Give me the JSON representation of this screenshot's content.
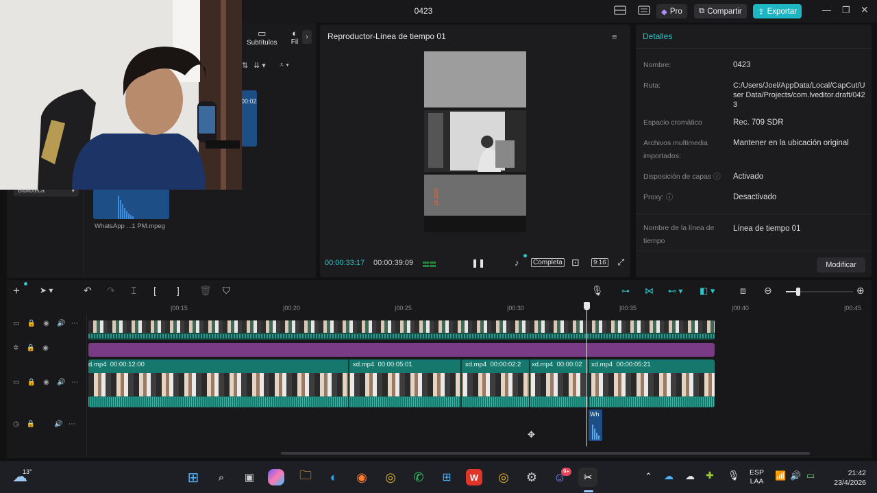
{
  "titlebar": {
    "title": "0423",
    "pro_label": "Pro",
    "share_label": "Compartir",
    "export_label": "Exportar"
  },
  "media": {
    "tabs": [
      "Subtítulos",
      "Fil"
    ],
    "library_label": "Biblioteca",
    "clip_time": "00:02",
    "clip_file": "WhatsApp ...1 PM.mpeg",
    "clip_ext_hint": "eg"
  },
  "player": {
    "title": "Reproductor-Línea de tiempo 01",
    "current_time": "00:00:33:17",
    "total_time": "00:00:39:09",
    "full_label": "Completa",
    "ratio_label": "9:16",
    "overlay_text": "23  2026"
  },
  "details": {
    "header": "Detalles",
    "rows": [
      {
        "label": "Nombre:",
        "value": "0423"
      },
      {
        "label": "Ruta:",
        "value": "C:/Users/Joel/AppData/Local/CapCut/User Data/Projects/com.lveditor.draft/0423"
      },
      {
        "label": "Espacio cromático",
        "value": "Rec. 709 SDR"
      },
      {
        "label": "Archivos multimedia importados:",
        "value": "Mantener en la ubicación original"
      },
      {
        "label": "Disposición de capas",
        "value": "Activado"
      },
      {
        "label": "Proxy:",
        "value": "Desactivado"
      },
      {
        "label": "Nombre de la línea de tiempo",
        "value": "Línea de tiempo 01"
      }
    ],
    "modify_label": "Modificar"
  },
  "timeline": {
    "ruler": [
      "|00:15",
      "|00:20",
      "|00:25",
      "|00:30",
      "|00:35",
      "|00:40",
      "|00:45"
    ],
    "clips": [
      {
        "name": "d.mp4",
        "dur": "00:00:12:00"
      },
      {
        "name": "xd.mp4",
        "dur": "00:00:05:01"
      },
      {
        "name": "xd.mp4",
        "dur": "00:00:02:2"
      },
      {
        "name": "xd.mp4",
        "dur": "00:00:02"
      },
      {
        "name": "xd.mp4",
        "dur": "00:00:05:21"
      }
    ],
    "audio_clip_label": "Wh"
  },
  "taskbar": {
    "weather_temp": "13°",
    "lang_top": "ESP",
    "lang_bottom": "LAA",
    "time": "21:42",
    "date": "23/4/2026",
    "badge_count": "9+"
  },
  "colors": {
    "accent": "#2fc4c9",
    "export": "#1fb6c4",
    "purple_track": "#7a3b86",
    "teal_track": "#16776c"
  }
}
